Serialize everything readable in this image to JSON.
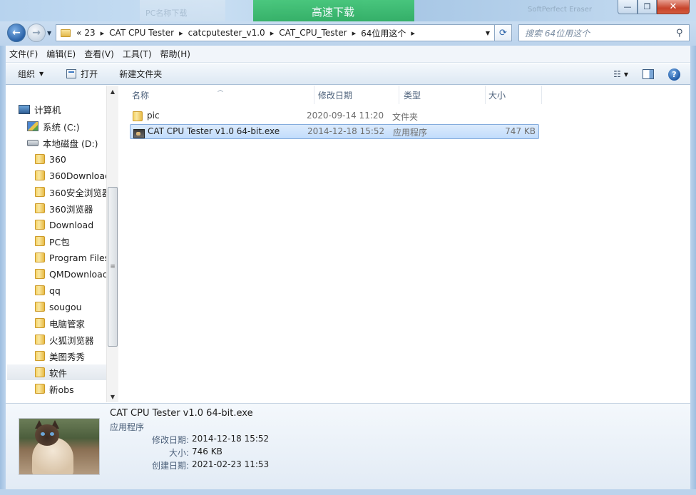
{
  "window": {
    "bg_ads": [
      "PC名称下载",
      "高速下载",
      "SoftPerfect Eraser"
    ],
    "controls": {
      "minimize": "—",
      "maximize": "❐",
      "close": "✕"
    }
  },
  "nav": {
    "back_icon": "←",
    "forward_icon": "→",
    "overflow": "«",
    "breadcrumbs": [
      "23",
      "CAT CPU Tester",
      "catcputester_v1.0",
      "CAT_CPU_Tester",
      "64位用这个"
    ],
    "search_placeholder": "搜索 64位用这个"
  },
  "menu": [
    "文件(F)",
    "编辑(E)",
    "查看(V)",
    "工具(T)",
    "帮助(H)"
  ],
  "commands": {
    "organize": "组织",
    "open": "打开",
    "new_folder": "新建文件夹"
  },
  "tree": {
    "computer": "计算机",
    "drive_c": "系统 (C:)",
    "drive_d": "本地磁盘 (D:)",
    "folders": [
      "360",
      "360Download",
      "360安全浏览器",
      "360浏览器",
      "Download",
      "PC包",
      "Program Files",
      "QMDownload",
      "qq",
      "sougou",
      "电脑管家",
      "火狐浏览器",
      "美图秀秀",
      "软件",
      "新obs"
    ],
    "selected_folder": "软件"
  },
  "columns": [
    "名称",
    "修改日期",
    "类型",
    "大小"
  ],
  "files": [
    {
      "name": "pic",
      "date": "2020-09-14 11:20",
      "type": "文件夹",
      "size": "",
      "kind": "folder"
    },
    {
      "name": "CAT CPU Tester v1.0 64-bit.exe",
      "date": "2014-12-18 15:52",
      "type": "应用程序",
      "size": "747 KB",
      "kind": "exe"
    }
  ],
  "details": {
    "title": "CAT CPU Tester v1.0 64-bit.exe",
    "type": "应用程序",
    "modified_label": "修改日期:",
    "modified_value": "2014-12-18 15:52",
    "size_label": "大小:",
    "size_value": "746 KB",
    "created_label": "创建日期:",
    "created_value": "2021-02-23 11:53"
  }
}
